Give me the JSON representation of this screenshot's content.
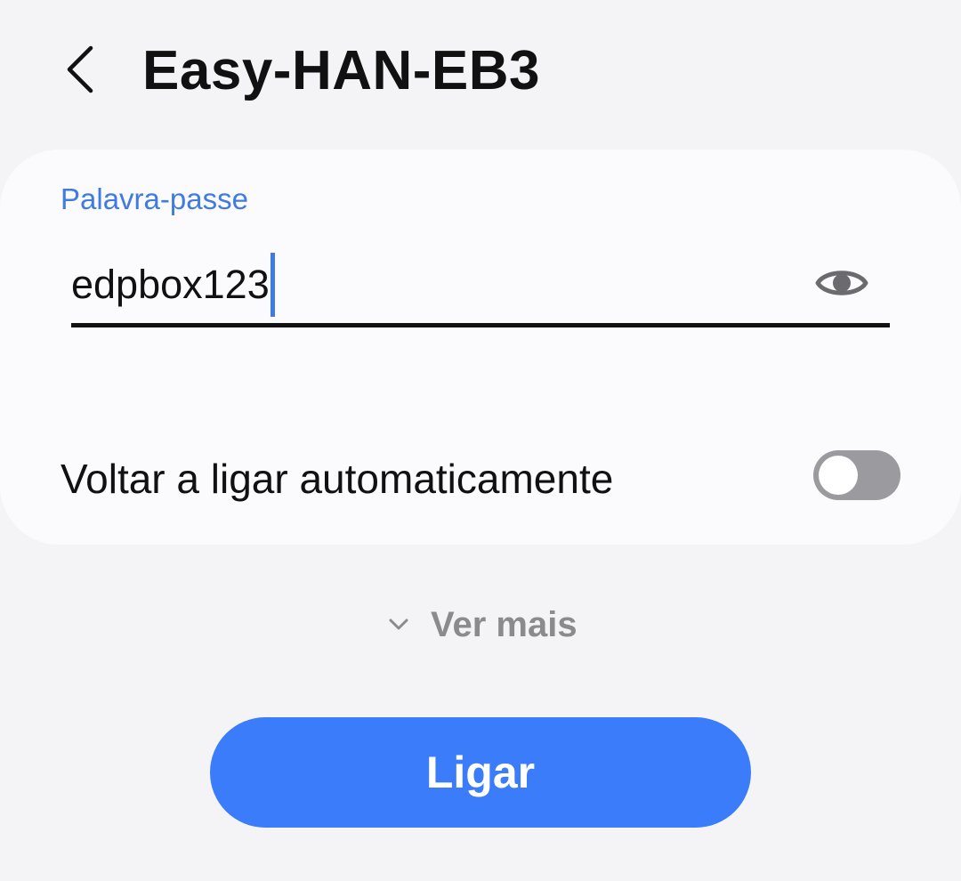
{
  "header": {
    "back_icon": "chevron-left-icon",
    "title": "Easy-HAN-EB3"
  },
  "password": {
    "label": "Palavra-passe",
    "value": "edpbox123",
    "visibility_icon": "eye-icon"
  },
  "auto_reconnect": {
    "label": "Voltar a ligar automaticamente",
    "enabled": false
  },
  "see_more": {
    "icon": "chevron-down-icon",
    "label": "Ver mais"
  },
  "connect_button": {
    "label": "Ligar"
  },
  "colors": {
    "accent": "#3b7cfb",
    "label_accent": "#3f7be0",
    "background": "#f4f4f6",
    "card": "#fbfbfd",
    "toggle_off": "#9b9b9f"
  }
}
